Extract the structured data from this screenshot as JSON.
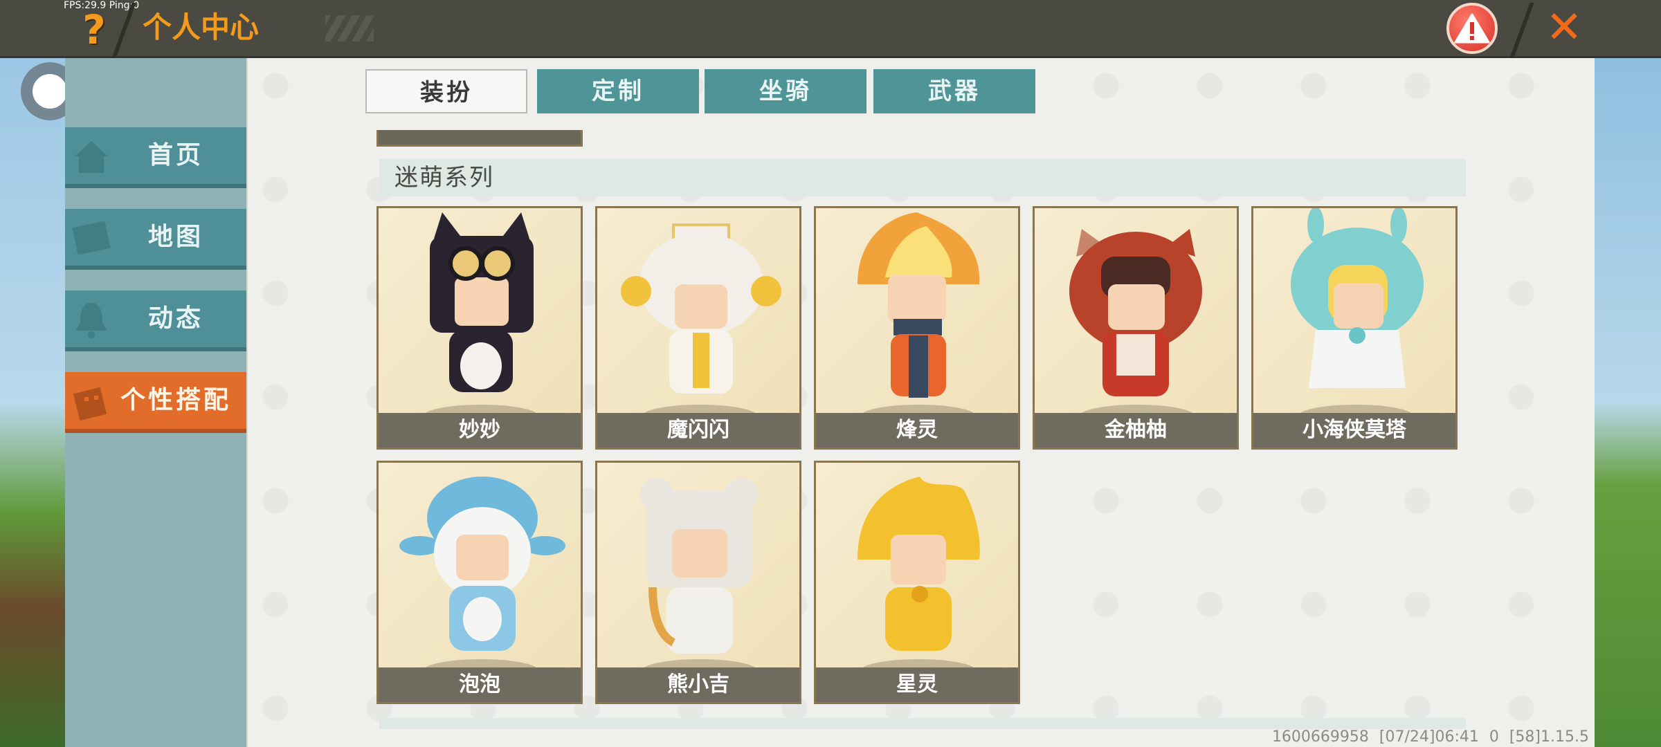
{
  "hud": {
    "fps_text": "FPS:29.9  Ping:0"
  },
  "header": {
    "title": "个人中心",
    "help_glyph": "?",
    "close_glyph": "✕",
    "warn_glyph": "!"
  },
  "sidebar": {
    "items": [
      {
        "label": "首页",
        "icon": "house-icon",
        "active": false
      },
      {
        "label": "地图",
        "icon": "map-icon",
        "active": false
      },
      {
        "label": "动态",
        "icon": "bell-icon",
        "active": false
      },
      {
        "label": "个性搭配",
        "icon": "wardrobe-icon",
        "active": true
      }
    ]
  },
  "tabs": [
    {
      "label": "装扮",
      "active": true
    },
    {
      "label": "定制",
      "active": false
    },
    {
      "label": "坐骑",
      "active": false
    },
    {
      "label": "武器",
      "active": false
    }
  ],
  "section": {
    "title": "迷萌系列"
  },
  "skins": [
    {
      "name": "妙妙",
      "color": "#2a2430"
    },
    {
      "name": "魔闪闪",
      "color": "#f3efe8"
    },
    {
      "name": "烽灵",
      "color": "#f2a23a"
    },
    {
      "name": "金柚柚",
      "color": "#b8432a"
    },
    {
      "name": "小海侠莫塔",
      "color": "#7fd0cf"
    },
    {
      "name": "泡泡",
      "color": "#6fb9dc"
    },
    {
      "name": "熊小吉",
      "color": "#e9e6e0"
    },
    {
      "name": "星灵",
      "color": "#f3c12e"
    }
  ],
  "footer": {
    "text": "1600669958   [07/24]06:41 0   [58]1.15.5"
  },
  "colors": {
    "accent_orange": "#f59a1a",
    "teal": "#4f9597",
    "active_orange": "#e26d2a"
  }
}
